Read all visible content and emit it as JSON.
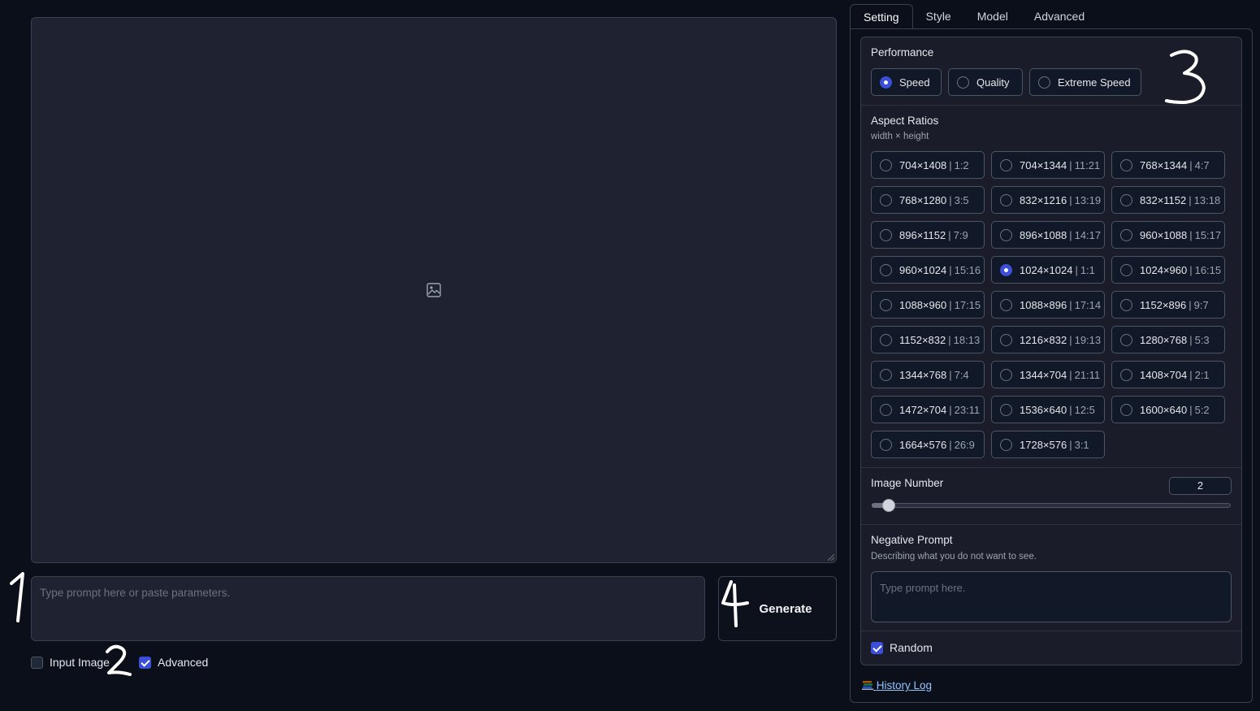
{
  "prompt": {
    "placeholder": "Type prompt here or paste parameters.",
    "generate_label": "Generate"
  },
  "options": {
    "input_image_label": "Input Image",
    "input_image_checked": false,
    "advanced_label": "Advanced",
    "advanced_checked": true
  },
  "tabs": [
    {
      "label": "Setting",
      "active": true
    },
    {
      "label": "Style",
      "active": false
    },
    {
      "label": "Model",
      "active": false
    },
    {
      "label": "Advanced",
      "active": false
    }
  ],
  "performance": {
    "label": "Performance",
    "options": [
      "Speed",
      "Quality",
      "Extreme Speed"
    ],
    "selected": "Speed"
  },
  "aspect_ratios": {
    "label": "Aspect Ratios",
    "sublabel": "width × height",
    "selected": "1024×1024",
    "options": [
      {
        "size": "704×1408",
        "ratio": "1:2"
      },
      {
        "size": "704×1344",
        "ratio": "11:21"
      },
      {
        "size": "768×1344",
        "ratio": "4:7"
      },
      {
        "size": "768×1280",
        "ratio": "3:5"
      },
      {
        "size": "832×1216",
        "ratio": "13:19"
      },
      {
        "size": "832×1152",
        "ratio": "13:18"
      },
      {
        "size": "896×1152",
        "ratio": "7:9"
      },
      {
        "size": "896×1088",
        "ratio": "14:17"
      },
      {
        "size": "960×1088",
        "ratio": "15:17"
      },
      {
        "size": "960×1024",
        "ratio": "15:16"
      },
      {
        "size": "1024×1024",
        "ratio": "1:1"
      },
      {
        "size": "1024×960",
        "ratio": "16:15"
      },
      {
        "size": "1088×960",
        "ratio": "17:15"
      },
      {
        "size": "1088×896",
        "ratio": "17:14"
      },
      {
        "size": "1152×896",
        "ratio": "9:7"
      },
      {
        "size": "1152×832",
        "ratio": "18:13"
      },
      {
        "size": "1216×832",
        "ratio": "19:13"
      },
      {
        "size": "1280×768",
        "ratio": "5:3"
      },
      {
        "size": "1344×768",
        "ratio": "7:4"
      },
      {
        "size": "1344×704",
        "ratio": "21:11"
      },
      {
        "size": "1408×704",
        "ratio": "2:1"
      },
      {
        "size": "1472×704",
        "ratio": "23:11"
      },
      {
        "size": "1536×640",
        "ratio": "12:5"
      },
      {
        "size": "1600×640",
        "ratio": "5:2"
      },
      {
        "size": "1664×576",
        "ratio": "26:9"
      },
      {
        "size": "1728×576",
        "ratio": "3:1"
      }
    ]
  },
  "image_number": {
    "label": "Image Number",
    "value": "2",
    "slider_fraction": 0.05
  },
  "negative_prompt": {
    "label": "Negative Prompt",
    "sublabel": "Describing what you do not want to see.",
    "placeholder": "Type prompt here."
  },
  "random": {
    "label": "Random",
    "checked": true
  },
  "history": {
    "icon": "books-icon",
    "label": "History Log"
  },
  "annotations": [
    "1",
    "2",
    "3",
    "4"
  ],
  "colors": {
    "accent": "#3b4fd8",
    "background": "#0b0f19",
    "panel": "#1a1d29"
  }
}
